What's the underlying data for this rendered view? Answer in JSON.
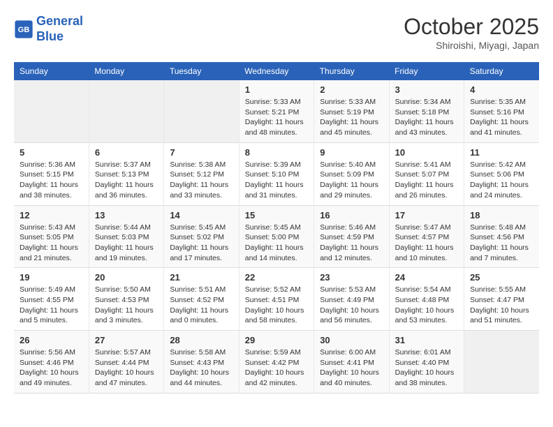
{
  "header": {
    "logo_line1": "General",
    "logo_line2": "Blue",
    "month": "October 2025",
    "location": "Shiroishi, Miyagi, Japan"
  },
  "weekdays": [
    "Sunday",
    "Monday",
    "Tuesday",
    "Wednesday",
    "Thursday",
    "Friday",
    "Saturday"
  ],
  "weeks": [
    [
      {
        "day": "",
        "empty": true
      },
      {
        "day": "",
        "empty": true
      },
      {
        "day": "",
        "empty": true
      },
      {
        "day": "1",
        "sunrise": "5:33 AM",
        "sunset": "5:21 PM",
        "daylight": "11 hours and 48 minutes."
      },
      {
        "day": "2",
        "sunrise": "5:33 AM",
        "sunset": "5:19 PM",
        "daylight": "11 hours and 45 minutes."
      },
      {
        "day": "3",
        "sunrise": "5:34 AM",
        "sunset": "5:18 PM",
        "daylight": "11 hours and 43 minutes."
      },
      {
        "day": "4",
        "sunrise": "5:35 AM",
        "sunset": "5:16 PM",
        "daylight": "11 hours and 41 minutes."
      }
    ],
    [
      {
        "day": "5",
        "sunrise": "5:36 AM",
        "sunset": "5:15 PM",
        "daylight": "11 hours and 38 minutes."
      },
      {
        "day": "6",
        "sunrise": "5:37 AM",
        "sunset": "5:13 PM",
        "daylight": "11 hours and 36 minutes."
      },
      {
        "day": "7",
        "sunrise": "5:38 AM",
        "sunset": "5:12 PM",
        "daylight": "11 hours and 33 minutes."
      },
      {
        "day": "8",
        "sunrise": "5:39 AM",
        "sunset": "5:10 PM",
        "daylight": "11 hours and 31 minutes."
      },
      {
        "day": "9",
        "sunrise": "5:40 AM",
        "sunset": "5:09 PM",
        "daylight": "11 hours and 29 minutes."
      },
      {
        "day": "10",
        "sunrise": "5:41 AM",
        "sunset": "5:07 PM",
        "daylight": "11 hours and 26 minutes."
      },
      {
        "day": "11",
        "sunrise": "5:42 AM",
        "sunset": "5:06 PM",
        "daylight": "11 hours and 24 minutes."
      }
    ],
    [
      {
        "day": "12",
        "sunrise": "5:43 AM",
        "sunset": "5:05 PM",
        "daylight": "11 hours and 21 minutes."
      },
      {
        "day": "13",
        "sunrise": "5:44 AM",
        "sunset": "5:03 PM",
        "daylight": "11 hours and 19 minutes."
      },
      {
        "day": "14",
        "sunrise": "5:45 AM",
        "sunset": "5:02 PM",
        "daylight": "11 hours and 17 minutes."
      },
      {
        "day": "15",
        "sunrise": "5:45 AM",
        "sunset": "5:00 PM",
        "daylight": "11 hours and 14 minutes."
      },
      {
        "day": "16",
        "sunrise": "5:46 AM",
        "sunset": "4:59 PM",
        "daylight": "11 hours and 12 minutes."
      },
      {
        "day": "17",
        "sunrise": "5:47 AM",
        "sunset": "4:57 PM",
        "daylight": "11 hours and 10 minutes."
      },
      {
        "day": "18",
        "sunrise": "5:48 AM",
        "sunset": "4:56 PM",
        "daylight": "11 hours and 7 minutes."
      }
    ],
    [
      {
        "day": "19",
        "sunrise": "5:49 AM",
        "sunset": "4:55 PM",
        "daylight": "11 hours and 5 minutes."
      },
      {
        "day": "20",
        "sunrise": "5:50 AM",
        "sunset": "4:53 PM",
        "daylight": "11 hours and 3 minutes."
      },
      {
        "day": "21",
        "sunrise": "5:51 AM",
        "sunset": "4:52 PM",
        "daylight": "11 hours and 0 minutes."
      },
      {
        "day": "22",
        "sunrise": "5:52 AM",
        "sunset": "4:51 PM",
        "daylight": "10 hours and 58 minutes."
      },
      {
        "day": "23",
        "sunrise": "5:53 AM",
        "sunset": "4:49 PM",
        "daylight": "10 hours and 56 minutes."
      },
      {
        "day": "24",
        "sunrise": "5:54 AM",
        "sunset": "4:48 PM",
        "daylight": "10 hours and 53 minutes."
      },
      {
        "day": "25",
        "sunrise": "5:55 AM",
        "sunset": "4:47 PM",
        "daylight": "10 hours and 51 minutes."
      }
    ],
    [
      {
        "day": "26",
        "sunrise": "5:56 AM",
        "sunset": "4:46 PM",
        "daylight": "10 hours and 49 minutes."
      },
      {
        "day": "27",
        "sunrise": "5:57 AM",
        "sunset": "4:44 PM",
        "daylight": "10 hours and 47 minutes."
      },
      {
        "day": "28",
        "sunrise": "5:58 AM",
        "sunset": "4:43 PM",
        "daylight": "10 hours and 44 minutes."
      },
      {
        "day": "29",
        "sunrise": "5:59 AM",
        "sunset": "4:42 PM",
        "daylight": "10 hours and 42 minutes."
      },
      {
        "day": "30",
        "sunrise": "6:00 AM",
        "sunset": "4:41 PM",
        "daylight": "10 hours and 40 minutes."
      },
      {
        "day": "31",
        "sunrise": "6:01 AM",
        "sunset": "4:40 PM",
        "daylight": "10 hours and 38 minutes."
      },
      {
        "day": "",
        "empty": true
      }
    ]
  ]
}
